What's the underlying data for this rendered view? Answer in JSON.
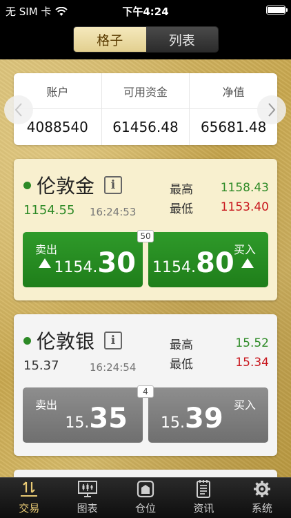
{
  "status_bar": {
    "carrier": "无 SIM 卡",
    "time": "下午4:24",
    "battery_level": 0.95
  },
  "segment": {
    "grid": "格子",
    "list": "列表"
  },
  "account": {
    "columns": [
      {
        "label": "账户",
        "value": "4088540"
      },
      {
        "label": "可用资金",
        "value": "61456.48"
      },
      {
        "label": "净值",
        "value": "65681.48"
      }
    ]
  },
  "instruments": [
    {
      "name": "伦敦金",
      "price": "1154.55",
      "time": "16:24:53",
      "high_label": "最高",
      "high": "1158.43",
      "low_label": "最低",
      "low": "1153.40",
      "spread": "50",
      "sell": {
        "label": "卖出",
        "small": "1154.",
        "big": "30"
      },
      "buy": {
        "label": "买入",
        "small": "1154.",
        "big": "80"
      }
    },
    {
      "name": "伦敦银",
      "price": "15.37",
      "time": "16:24:54",
      "high_label": "最高",
      "high": "15.52",
      "low_label": "最低",
      "low": "15.34",
      "spread": "4",
      "sell": {
        "label": "卖出",
        "small": "15.",
        "big": "35"
      },
      "buy": {
        "label": "买入",
        "small": "15.",
        "big": "39"
      }
    }
  ],
  "tabs": [
    {
      "label": "交易",
      "icon": "trade-icon"
    },
    {
      "label": "图表",
      "icon": "chart-icon"
    },
    {
      "label": "仓位",
      "icon": "position-icon"
    },
    {
      "label": "资讯",
      "icon": "news-icon"
    },
    {
      "label": "系统",
      "icon": "gear-icon"
    }
  ],
  "colors": {
    "accent_gold": "#e8c974",
    "up_green": "#2d8a26",
    "down_red": "#c8161d",
    "neutral_text": "#333333"
  }
}
